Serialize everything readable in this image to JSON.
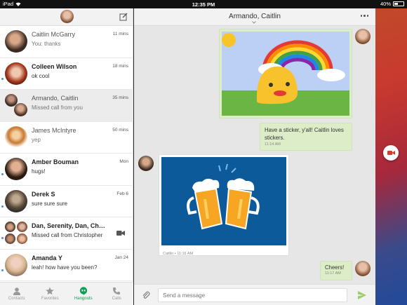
{
  "status_bar": {
    "device": "iPad",
    "time": "12:35 PM",
    "battery": "40%",
    "battery_level": 0.4
  },
  "left_panel": {
    "conversations": [
      {
        "name": "Caitlin McGarry",
        "snippet": "You: thanks",
        "time": "11 mins",
        "unread": false
      },
      {
        "name": "Colleen Wilson",
        "snippet": "ok cool",
        "time": "18 mins",
        "unread": true
      },
      {
        "name": "Armando, Caitlin",
        "snippet": "Missed call from you",
        "time": "35 mins",
        "unread": false
      },
      {
        "name": "James McIntyre",
        "snippet": "yep",
        "time": "50 mins",
        "unread": false
      },
      {
        "name": "Amber Bouman",
        "snippet": "hugs!",
        "time": "Mon",
        "unread": true
      },
      {
        "name": "Derek S",
        "snippet": "sure sure sure",
        "time": "Feb 6",
        "unread": true
      },
      {
        "name": "Dan, Serenity, Dan, Chris...",
        "snippet": "Missed call from Christopher",
        "time": "",
        "unread": true
      },
      {
        "name": "Amanda Y",
        "snippet": "leah! how have you been?",
        "time": "Jan 24",
        "unread": true
      }
    ],
    "tabs": [
      "Contacts",
      "Favorites",
      "Hangouts",
      "Calls"
    ],
    "active_tab": "Hangouts"
  },
  "chat": {
    "title": "Armando, Caitlin",
    "messages": {
      "outgoing_1_text": "Have a sticker, y'all! Caitlin loves stickers.",
      "outgoing_1_time": "11:14 AM",
      "incoming_meta": "Caitlin • 11:16 AM",
      "outgoing_2_text": "Cheers!",
      "outgoing_2_time": "11:17 AM"
    },
    "input_placeholder": "Send a message"
  },
  "colors": {
    "accent_green": "#0f9d58",
    "bubble_out": "#dcedc8",
    "sticker_bg": "#0d5a9a",
    "call_red": "#d23f31"
  }
}
